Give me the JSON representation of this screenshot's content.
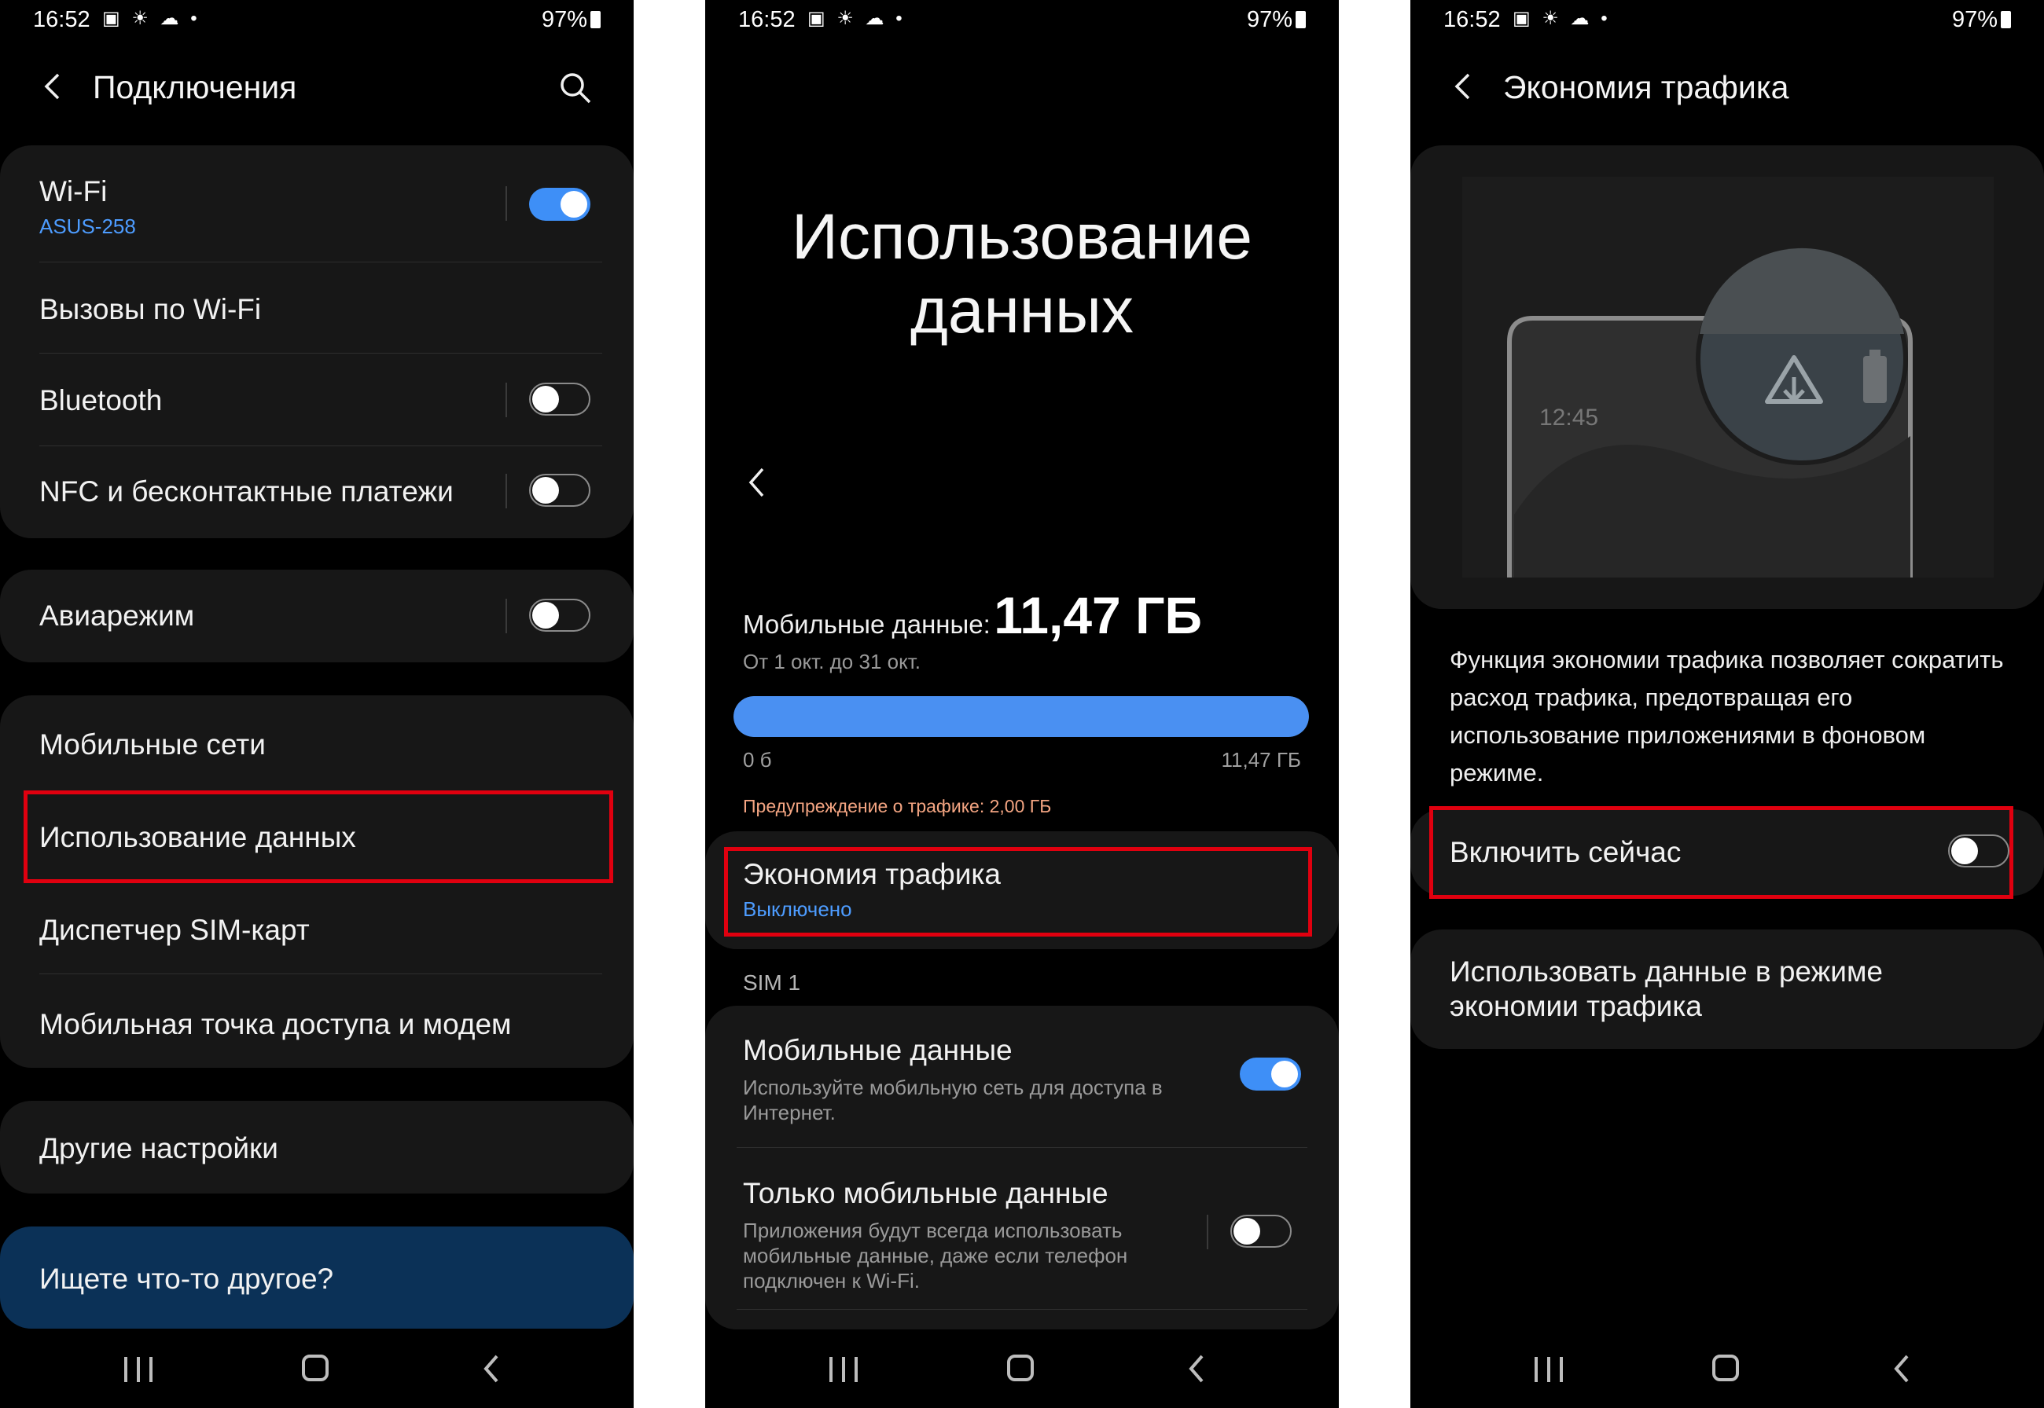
{
  "status": {
    "time": "16:52",
    "battery": "97%",
    "notif_icons": "▣ ☀ ☁ •"
  },
  "screen1": {
    "title": "Подключения",
    "wifi": {
      "label": "Wi-Fi",
      "network": "ASUS-258",
      "on": true
    },
    "wifi_calls": "Вызовы по Wi-Fi",
    "bluetooth": {
      "label": "Bluetooth",
      "on": false
    },
    "nfc": {
      "label": "NFC и бесконтактные платежи",
      "on": false
    },
    "airplane": {
      "label": "Авиарежим",
      "on": false
    },
    "mobile_networks": "Мобильные сети",
    "data_usage": "Использование данных",
    "sim_manager": "Диспетчер SIM-карт",
    "hotspot": "Мобильная точка доступа и модем",
    "other_settings": "Другие настройки",
    "looking_for": "Ищете что-то другое?"
  },
  "screen2": {
    "big_title_line1": "Использование",
    "big_title_line2": "данных",
    "mobile_label": "Мобильные данные:",
    "mobile_value": "11,47 ГБ",
    "period": "От 1 окт. до 31 окт.",
    "usage_fraction": 1.0,
    "bar_min": "0 б",
    "bar_max": "11,47 ГБ",
    "warning": "Предупреждение о трафике: 2,00 ГБ",
    "saver": {
      "label": "Экономия трафика",
      "state": "Выключено"
    },
    "sim_header": "SIM 1",
    "mobile_data": {
      "label": "Мобильные данные",
      "desc": "Используйте мобильную сеть для доступа в Интернет.",
      "on": true
    },
    "only_mobile": {
      "label": "Только мобильные данные",
      "desc": "Приложения будут всегда использовать мобильные данные, даже если телефон подключен к Wi-Fi.",
      "on": false
    }
  },
  "screen3": {
    "title": "Экономия трафика",
    "illustration_time": "12:45",
    "description": "Функция экономии трафика позволяет сократить расход трафика, предотвращая его использование приложениями в фоновом режиме.",
    "enable_now": {
      "label": "Включить сейчас",
      "on": false
    },
    "use_data": "Использовать данные в режиме экономии трафика"
  },
  "colors": {
    "accent": "#3e8ff7",
    "highlight": "#e0000f",
    "warning": "#f4a582",
    "card": "#171717",
    "search_card": "#0b3157"
  }
}
